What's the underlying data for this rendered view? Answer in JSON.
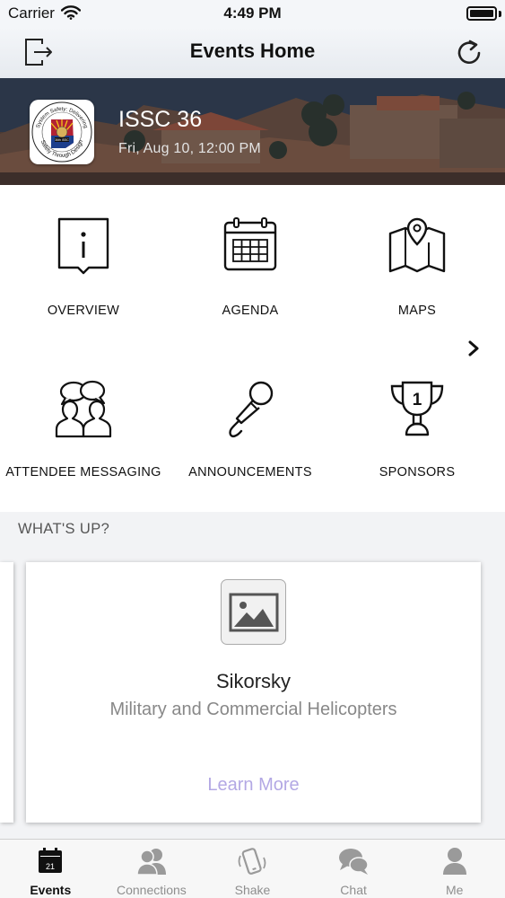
{
  "status_bar": {
    "carrier": "Carrier",
    "time": "4:49 PM"
  },
  "nav": {
    "title": "Events Home",
    "left_icon": "logout-icon",
    "right_icon": "refresh-icon"
  },
  "event": {
    "title": "ISSC 36",
    "date": "Fri, Aug 10, 12:00 PM",
    "logo": {
      "top_text": "System Safety: Delivering",
      "center_text": "36th ISSC",
      "bottom_text": "Safety Through Design"
    }
  },
  "grid": [
    {
      "label": "OVERVIEW",
      "icon": "info-icon"
    },
    {
      "label": "AGENDA",
      "icon": "calendar-icon"
    },
    {
      "label": "MAPS",
      "icon": "map-icon"
    },
    {
      "label": "ATTENDEE MESSAGING",
      "icon": "messaging-icon"
    },
    {
      "label": "ANNOUNCEMENTS",
      "icon": "microphone-icon"
    },
    {
      "label": "SPONSORS",
      "icon": "trophy-icon"
    }
  ],
  "sponsors_trophy_number": "1",
  "whats_up": {
    "title": "WHAT'S UP?",
    "card": {
      "title": "Sikorsky",
      "subtitle": "Military and Commercial Helicopters",
      "link": "Learn More"
    }
  },
  "tabs": [
    {
      "label": "Events",
      "icon": "calendar-icon",
      "active": true,
      "badge": "21"
    },
    {
      "label": "Connections",
      "icon": "people-icon",
      "active": false
    },
    {
      "label": "Shake",
      "icon": "phone-shake-icon",
      "active": false
    },
    {
      "label": "Chat",
      "icon": "chat-bubbles-icon",
      "active": false
    },
    {
      "label": "Me",
      "icon": "person-icon",
      "active": false
    }
  ],
  "colors": {
    "link": "#b3a8e4",
    "section_bg": "#f2f3f5",
    "nav_bg": "#f4f6f9"
  }
}
